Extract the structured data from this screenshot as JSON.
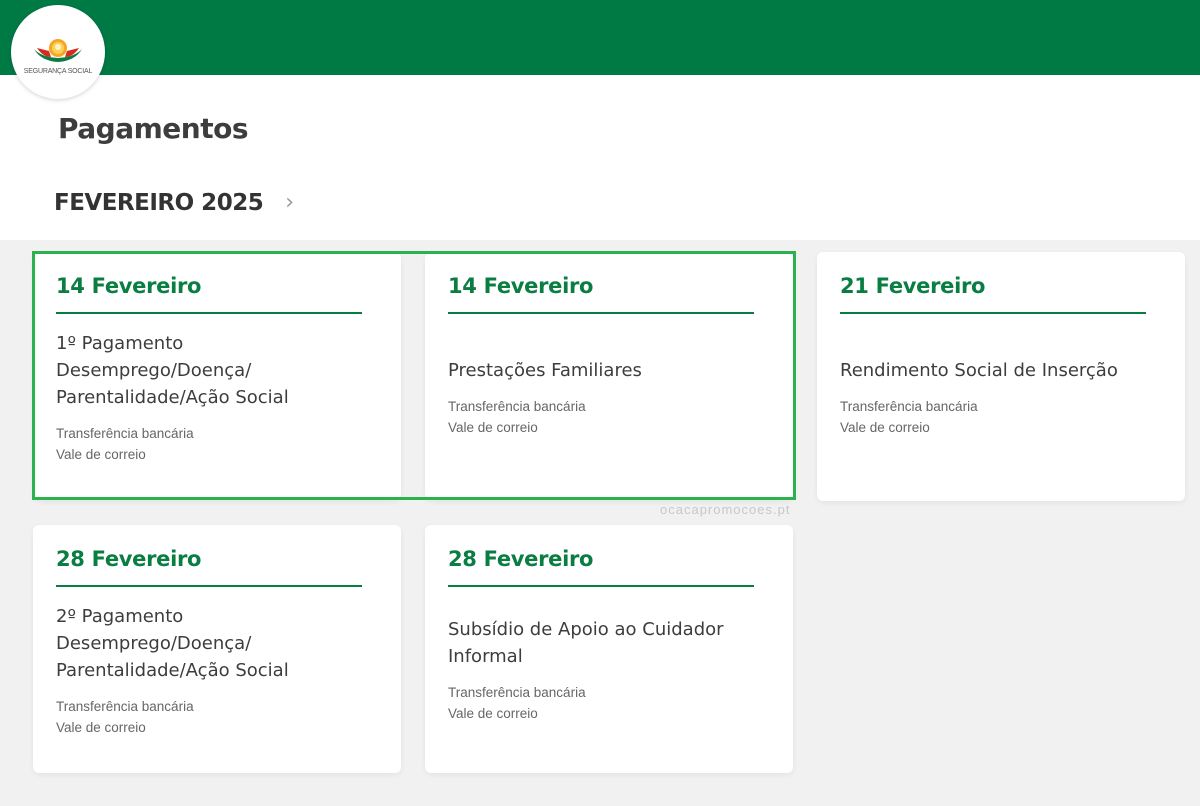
{
  "brand": {
    "logo_text": "SEGURANÇA SOCIAL",
    "header_color": "#007a45"
  },
  "page": {
    "title": "Pagamentos",
    "month": "FEVEREIRO 2025",
    "next_icon": "chevron-right-icon"
  },
  "cards": [
    {
      "date": "14 Fevereiro",
      "title": "1º Pagamento Desemprego/Doença/ Parentalidade/Ação Social",
      "methods": [
        "Transferência bancária",
        "Vale de correio"
      ]
    },
    {
      "date": "14 Fevereiro",
      "title": "Prestações Familiares",
      "methods": [
        "Transferência bancária",
        "Vale de correio"
      ]
    },
    {
      "date": "21 Fevereiro",
      "title": "Rendimento Social de Inserção",
      "methods": [
        "Transferência bancária",
        "Vale de correio"
      ]
    },
    {
      "date": "28 Fevereiro",
      "title": "2º Pagamento Desemprego/Doença/ Parentalidade/Ação Social",
      "methods": [
        "Transferência bancária",
        "Vale de correio"
      ]
    },
    {
      "date": "28 Fevereiro",
      "title": "Subsídio de Apoio ao Cuidador Informal",
      "methods": [
        "Transferência bancária",
        "Vale de correio"
      ]
    }
  ],
  "watermark": "ocacapromocoes.pt",
  "colors": {
    "accent_green": "#0a7d43",
    "highlight_green": "#2bb24c"
  }
}
